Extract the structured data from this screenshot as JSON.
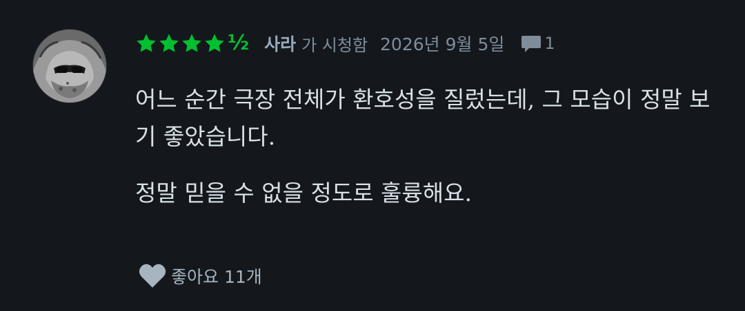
{
  "review": {
    "rating_half_symbol": "½",
    "rating_value": 4.5,
    "username": "사라",
    "watched_text": "가 시청함",
    "date": "2026년 9월 5일",
    "comment_count": "1",
    "paragraphs": [
      "어느 순간 극장 전체가 환호성을 질렀는데, 그 모습이 정말 보기 좋았습니다.",
      "정말 믿을 수 없을 정도로 훌륭해요."
    ],
    "likes_label": "좋아요 11개"
  },
  "colors": {
    "background": "#14181c",
    "star_green": "#00c030",
    "username": "#99aabb",
    "meta_gray": "#7f8d9b",
    "body_text": "#d8e0e8"
  },
  "icons": {
    "star": "star-icon",
    "comment": "comment-bubble-icon",
    "heart": "heart-icon"
  }
}
